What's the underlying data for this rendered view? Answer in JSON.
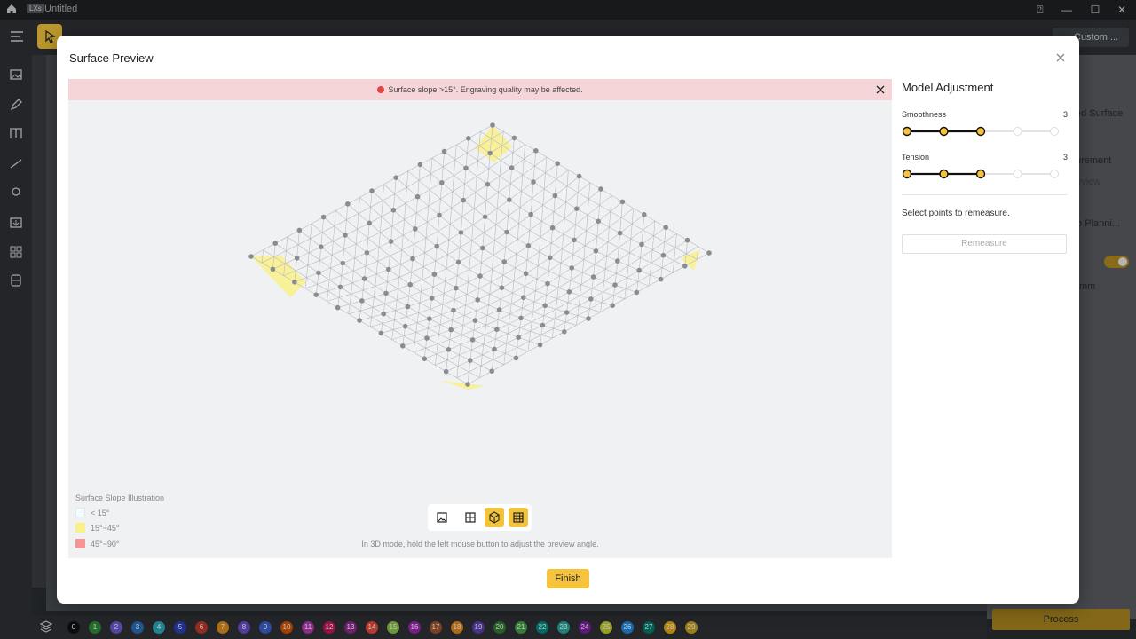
{
  "app": {
    "doc_title": "Untitled",
    "logo": "LXs",
    "custom_label": "Custom ...",
    "right_panel": {
      "surface_label": "ed Surface",
      "measure_label": "urement",
      "preview_label": "eview",
      "planning_label": "to Planni...",
      "unit_label": "mm"
    },
    "process_label": "Process",
    "layer_swatches": [
      {
        "n": "0",
        "color": "#111111"
      },
      {
        "n": "1",
        "color": "#2e8b3a"
      },
      {
        "n": "2",
        "color": "#6a5acd"
      },
      {
        "n": "3",
        "color": "#2a6fb8"
      },
      {
        "n": "4",
        "color": "#2aa8b8"
      },
      {
        "n": "5",
        "color": "#2a3fb8"
      },
      {
        "n": "6",
        "color": "#c0392b"
      },
      {
        "n": "7",
        "color": "#d98c1a"
      },
      {
        "n": "8",
        "color": "#6a4fc8"
      },
      {
        "n": "9",
        "color": "#3a5fcd"
      },
      {
        "n": "10",
        "color": "#d35400"
      },
      {
        "n": "11",
        "color": "#b03ab0"
      },
      {
        "n": "12",
        "color": "#c2185b"
      },
      {
        "n": "13",
        "color": "#8e2a8e"
      },
      {
        "n": "14",
        "color": "#e74c3c"
      },
      {
        "n": "15",
        "color": "#8bc34a"
      },
      {
        "n": "16",
        "color": "#9c27b0"
      },
      {
        "n": "17",
        "color": "#a0522d"
      },
      {
        "n": "18",
        "color": "#e08a1e"
      },
      {
        "n": "19",
        "color": "#5c3fb0"
      },
      {
        "n": "20",
        "color": "#2e7d32"
      },
      {
        "n": "21",
        "color": "#43a047"
      },
      {
        "n": "22",
        "color": "#00897b"
      },
      {
        "n": "23",
        "color": "#26a69a"
      },
      {
        "n": "24",
        "color": "#7b1fa2"
      },
      {
        "n": "25",
        "color": "#c0ca33"
      },
      {
        "n": "26",
        "color": "#1e88e5"
      },
      {
        "n": "27",
        "color": "#00796b"
      },
      {
        "n": "28",
        "color": "#e6a817"
      },
      {
        "n": "29",
        "color": "#c8a21e"
      }
    ]
  },
  "dialog": {
    "title": "Surface Preview",
    "warning": "Surface slope >15°. Engraving quality may be affected.",
    "legend": {
      "title": "Surface Slope Illustration",
      "items": [
        {
          "label": "< 15°",
          "color": "#f4fbff"
        },
        {
          "label": "15°~45°",
          "color": "#faf08a"
        },
        {
          "label": "45°~90°",
          "color": "#f49494"
        }
      ]
    },
    "view_tools": [
      {
        "name": "image-view-icon",
        "active": false
      },
      {
        "name": "height-map-icon",
        "active": false
      },
      {
        "name": "3d-model-icon",
        "active": true
      },
      {
        "name": "grid-mesh-icon",
        "active": true
      }
    ],
    "hint": "In 3D mode, hold the left mouse button to adjust the preview angle.",
    "finish_label": "Finish",
    "adjustment": {
      "title": "Model Adjustment",
      "smoothness": {
        "label": "Smoothness",
        "value": "3",
        "level": 3,
        "steps": 5
      },
      "tension": {
        "label": "Tension",
        "value": "3",
        "level": 3,
        "steps": 5
      },
      "select_text": "Select points to remeasure.",
      "remeasure_label": "Remeasure"
    },
    "colors": {
      "accent": "#f5c43c",
      "warning_bg": "#f5d5d7",
      "warning_dot": "#e34545",
      "mesh_line": "#b9bbbf",
      "point": "#8a8c90"
    }
  }
}
